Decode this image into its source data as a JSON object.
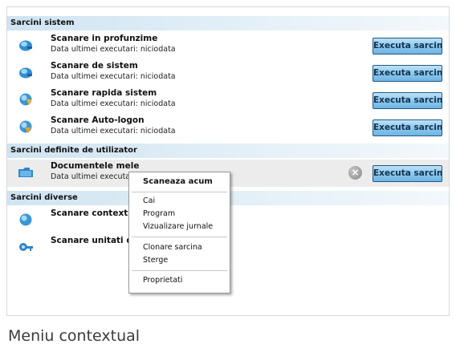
{
  "sections": {
    "system": {
      "title": "Sarcini sistem",
      "tasks": [
        {
          "name": "Scanare in profunzime",
          "subtitle": "Data ultimei executari: niciodata",
          "button": "Executa sarcina",
          "icon": "deep-scan-icon"
        },
        {
          "name": "Scanare de sistem",
          "subtitle": "Data ultimei executari: niciodata",
          "button": "Executa sarcina",
          "icon": "system-scan-icon"
        },
        {
          "name": "Scanare rapida sistem",
          "subtitle": "Data ultimei executari: niciodata",
          "button": "Executa sarcina",
          "icon": "quick-scan-icon"
        },
        {
          "name": "Scanare Auto-logon",
          "subtitle": "Data ultimei executari: niciodata",
          "button": "Executa sarcina",
          "icon": "autologon-scan-icon"
        }
      ]
    },
    "user": {
      "title": "Sarcini definite de utilizator",
      "tasks": [
        {
          "name": "Documentele mele",
          "subtitle": "Data ultimei executari: niciodata",
          "button": "Executa sarcina",
          "icon": "folder-icon"
        }
      ]
    },
    "misc": {
      "title": "Sarcini diverse",
      "tasks": [
        {
          "name": "Scanare contextuala",
          "icon": "contextual-scan-icon"
        },
        {
          "name": "Scanare unitati de",
          "icon": "drive-scan-icon"
        }
      ]
    }
  },
  "context_menu": {
    "items": [
      {
        "label": "Scaneaza acum",
        "default": true
      },
      {
        "label": "Cai"
      },
      {
        "label": "Program"
      },
      {
        "label": "Vizualizare jurnale"
      },
      {
        "label": "Clonare sarcina"
      },
      {
        "label": "Sterge"
      },
      {
        "label": "Proprietati"
      }
    ]
  },
  "caption": "Meniu contextual",
  "colors": {
    "header_gradient_start": "#cfe4f2",
    "button_blue": "#8cc8ee",
    "selected_row": "#ececec"
  }
}
